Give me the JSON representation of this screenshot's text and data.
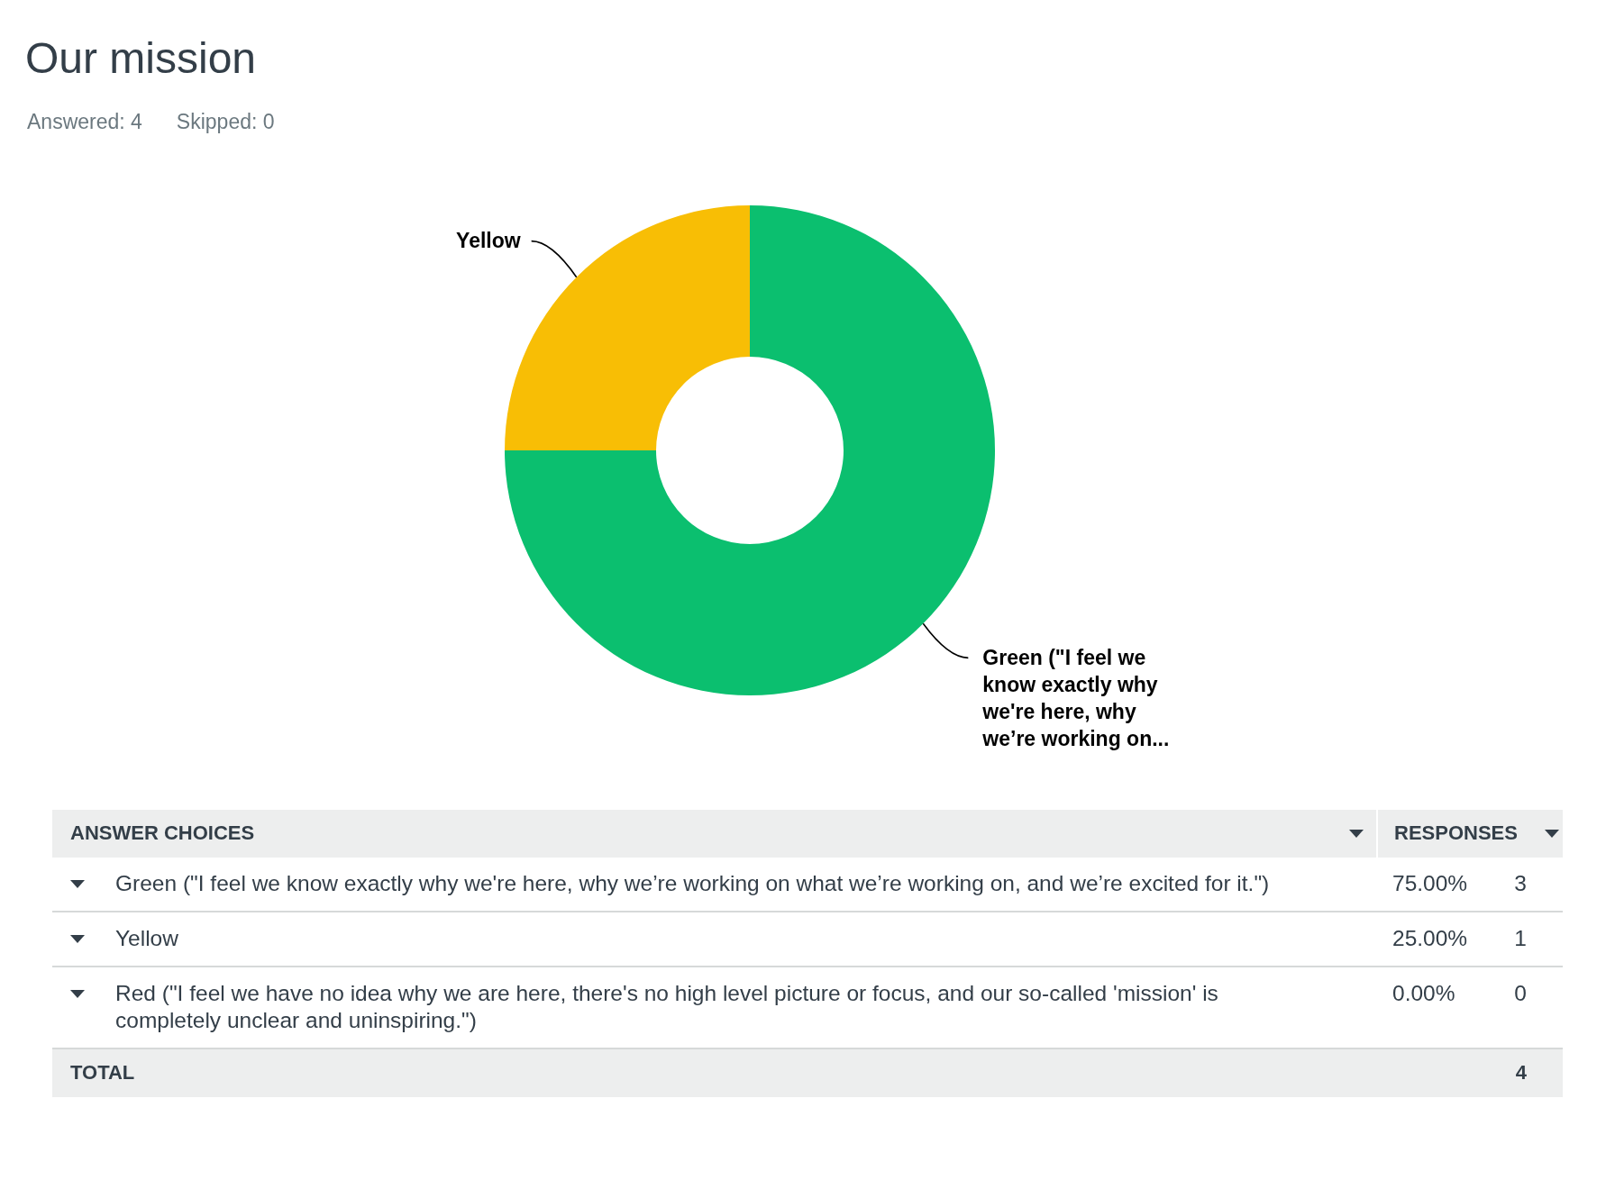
{
  "question": {
    "title": "Our mission",
    "answered": "Answered: 4",
    "skipped": "Skipped: 0"
  },
  "chart_data": {
    "type": "donut",
    "categories": [
      "Green (\"I feel we know exactly why we're here, why we’re working on...",
      "Yellow"
    ],
    "values": [
      75,
      25
    ],
    "colors": [
      "#0bbf6f",
      "#f8be05"
    ]
  },
  "table": {
    "columns": [
      {
        "label": "ANSWER CHOICES"
      },
      {
        "label": "RESPONSES"
      }
    ],
    "rows": [
      {
        "choice": "Green (\"I feel we know exactly why we're here, why we’re working on what we’re working on, and we’re excited for it.\")",
        "percent": "75.00%",
        "count": "3"
      },
      {
        "choice": "Yellow",
        "percent": "25.00%",
        "count": "1"
      },
      {
        "choice": "Red (\"I feel we have no idea why we are here, there's no high level picture or focus, and our so-called 'mission' is completely unclear and uninspiring.\")",
        "percent": "0.00%",
        "count": "0"
      }
    ],
    "total": {
      "label": "TOTAL",
      "count": "4"
    }
  }
}
